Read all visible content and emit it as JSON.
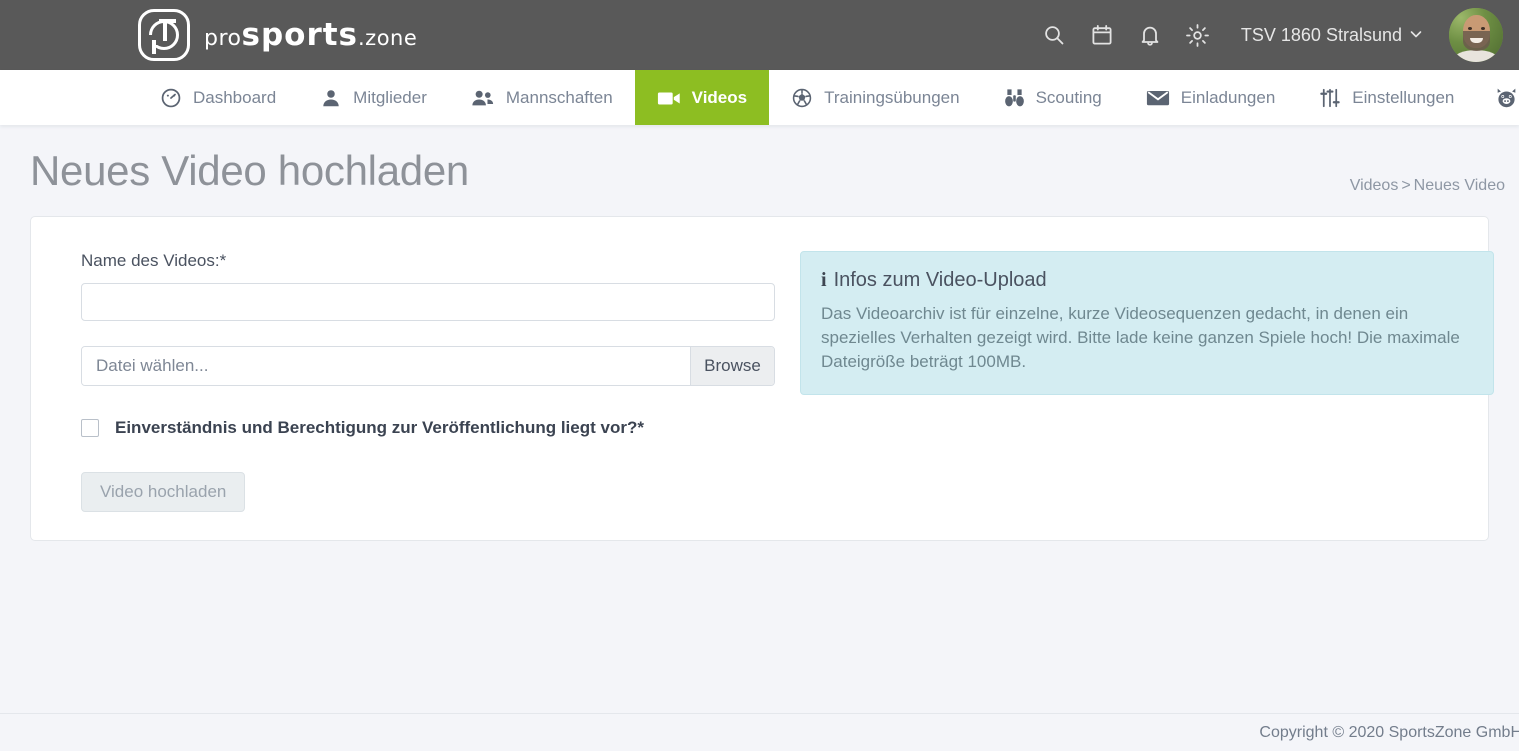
{
  "header": {
    "logo": {
      "pro": "pro",
      "sports": "sports",
      "zone": ".zone",
      "icon": "prosports-logo-icon"
    },
    "icons": [
      {
        "name": "search-icon",
        "label": "Suche"
      },
      {
        "name": "calendar-icon",
        "label": "Kalender"
      },
      {
        "name": "bell-icon",
        "label": "Benachrichtigungen"
      },
      {
        "name": "gear-icon",
        "label": "Einstellungen"
      }
    ],
    "team": "TSV 1860 Stralsund",
    "team_chevron": "chevron-down-icon",
    "avatar": "user-avatar"
  },
  "nav": {
    "items": [
      {
        "label": "Dashboard",
        "icon": "gauge-icon",
        "active": false
      },
      {
        "label": "Mitglieder",
        "icon": "person-icon",
        "active": false
      },
      {
        "label": "Mannschaften",
        "icon": "people-icon",
        "active": false
      },
      {
        "label": "Videos",
        "icon": "video-camera-icon",
        "active": true
      },
      {
        "label": "Trainingsübungen",
        "icon": "soccer-ball-icon",
        "active": false
      },
      {
        "label": "Scouting",
        "icon": "binoculars-icon",
        "active": false
      },
      {
        "label": "Einladungen",
        "icon": "envelope-icon",
        "active": false
      },
      {
        "label": "Einstellungen",
        "icon": "sliders-icon",
        "active": false
      },
      {
        "label": "",
        "icon": "pig-icon",
        "active": false
      }
    ],
    "active_color": "#8dbe22"
  },
  "page": {
    "title": "Neues Video hochladen",
    "breadcrumb": {
      "parent": "Videos",
      "separator": ">",
      "current": "Neues Video"
    }
  },
  "form": {
    "name_label": "Name des Videos:*",
    "name_value": "",
    "name_placeholder": "",
    "file_placeholder": "Datei wählen...",
    "browse_label": "Browse",
    "consent_label": "Einverständnis und Berechtigung zur Veröffentlichung liegt vor?*",
    "consent_checked": false,
    "submit_label": "Video hochladen",
    "submit_disabled": true
  },
  "info": {
    "icon": "info-icon",
    "title": "Infos zum Video-Upload",
    "body": "Das Videoarchiv ist für einzelne, kurze Videosequenzen gedacht, in denen ein spezielles Verhalten gezeigt wird. Bitte lade keine ganzen Spiele hoch! Die maximale Dateigröße beträgt 100MB.",
    "background": "#d4edf2"
  },
  "footer": {
    "copyright": "Copyright © 2020 SportsZone GmbH"
  }
}
